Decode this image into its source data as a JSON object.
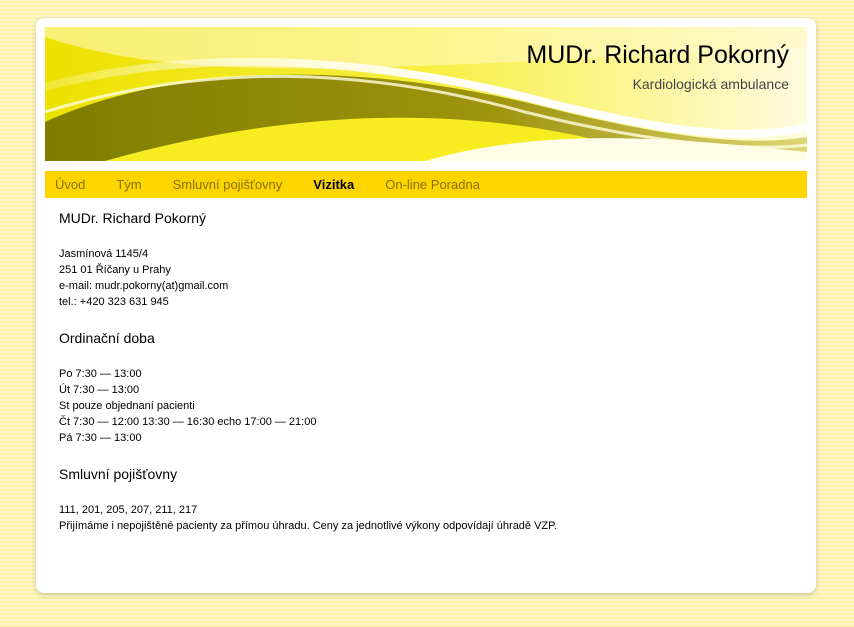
{
  "header": {
    "title": "MUDr. Richard Pokorný",
    "subtitle": "Kardiologická ambulance"
  },
  "nav": {
    "items": [
      {
        "label": "Úvod"
      },
      {
        "label": "Tým"
      },
      {
        "label": "Smluvní pojišťovny"
      },
      {
        "label": "Vizitka",
        "active": true
      },
      {
        "label": "On-line Poradna"
      }
    ]
  },
  "contact": {
    "heading": "MUDr. Richard Pokorný",
    "street": "Jasmínová 1145/4",
    "city": "251 01 Říčany u Prahy",
    "email": "e-mail: mudr.pokorny(at)gmail.com",
    "phone": "tel.: +420 323 631 945"
  },
  "hours": {
    "heading": "Ordinační doba",
    "lines": [
      "Po 7:30 — 13:00",
      "Út 7:30 — 13:00",
      "St pouze objednaní pacienti",
      "Čt 7:30 — 12:00 13:30 — 16:30 echo 17:00 — 21:00",
      "Pá 7:30 — 13:00"
    ]
  },
  "insurance": {
    "heading": "Smluvní pojišťovny",
    "codes": "111, 201, 205, 207, 211, 217",
    "note": "Přijímáme i nepojištěné pacienty za přímou úhradu. Ceny za jednotlivé výkony odpovídají úhradě VZP."
  },
  "colors": {
    "nav_bg": "#ffd500",
    "nav_link": "#8a6f00",
    "banner": "#f2e000"
  }
}
